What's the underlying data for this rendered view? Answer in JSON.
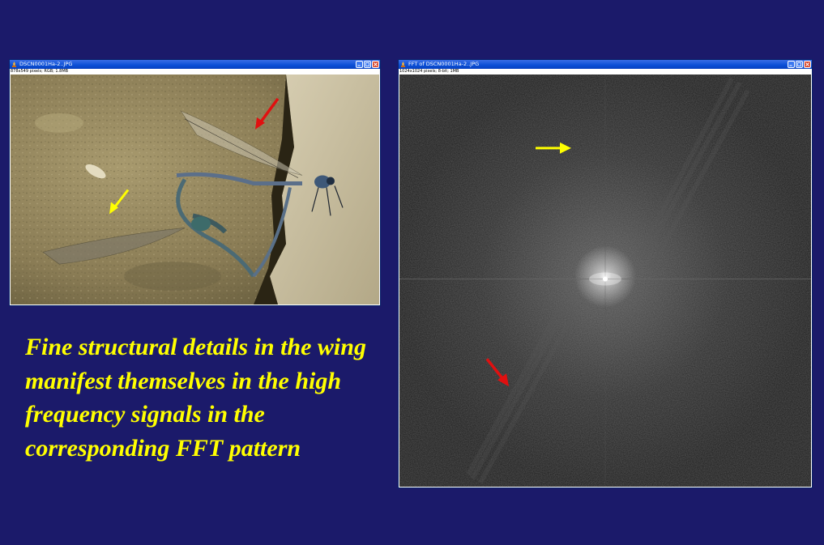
{
  "photo_window": {
    "title": "DSCN0001Ha-2..JPG",
    "info": "878x549 pixels; RGB; 1.8MB"
  },
  "fft_window": {
    "title": "FFT of DSCN0001Ha-2..JPG",
    "info": "1024x1024 pixels; 8-bit; 1MB"
  },
  "caption": "Fine structural details in the wing manifest themselves in the high frequency signals in the corresponding FFT pattern",
  "colors": {
    "background": "#1b1a6a",
    "caption": "#ffff00",
    "arrow_red": "#e01010",
    "arrow_yellow": "#ffff00"
  },
  "icons": [
    "app-icon",
    "minimize-icon",
    "maximize-icon",
    "close-icon",
    "red-arrow-icon",
    "yellow-arrow-icon"
  ]
}
